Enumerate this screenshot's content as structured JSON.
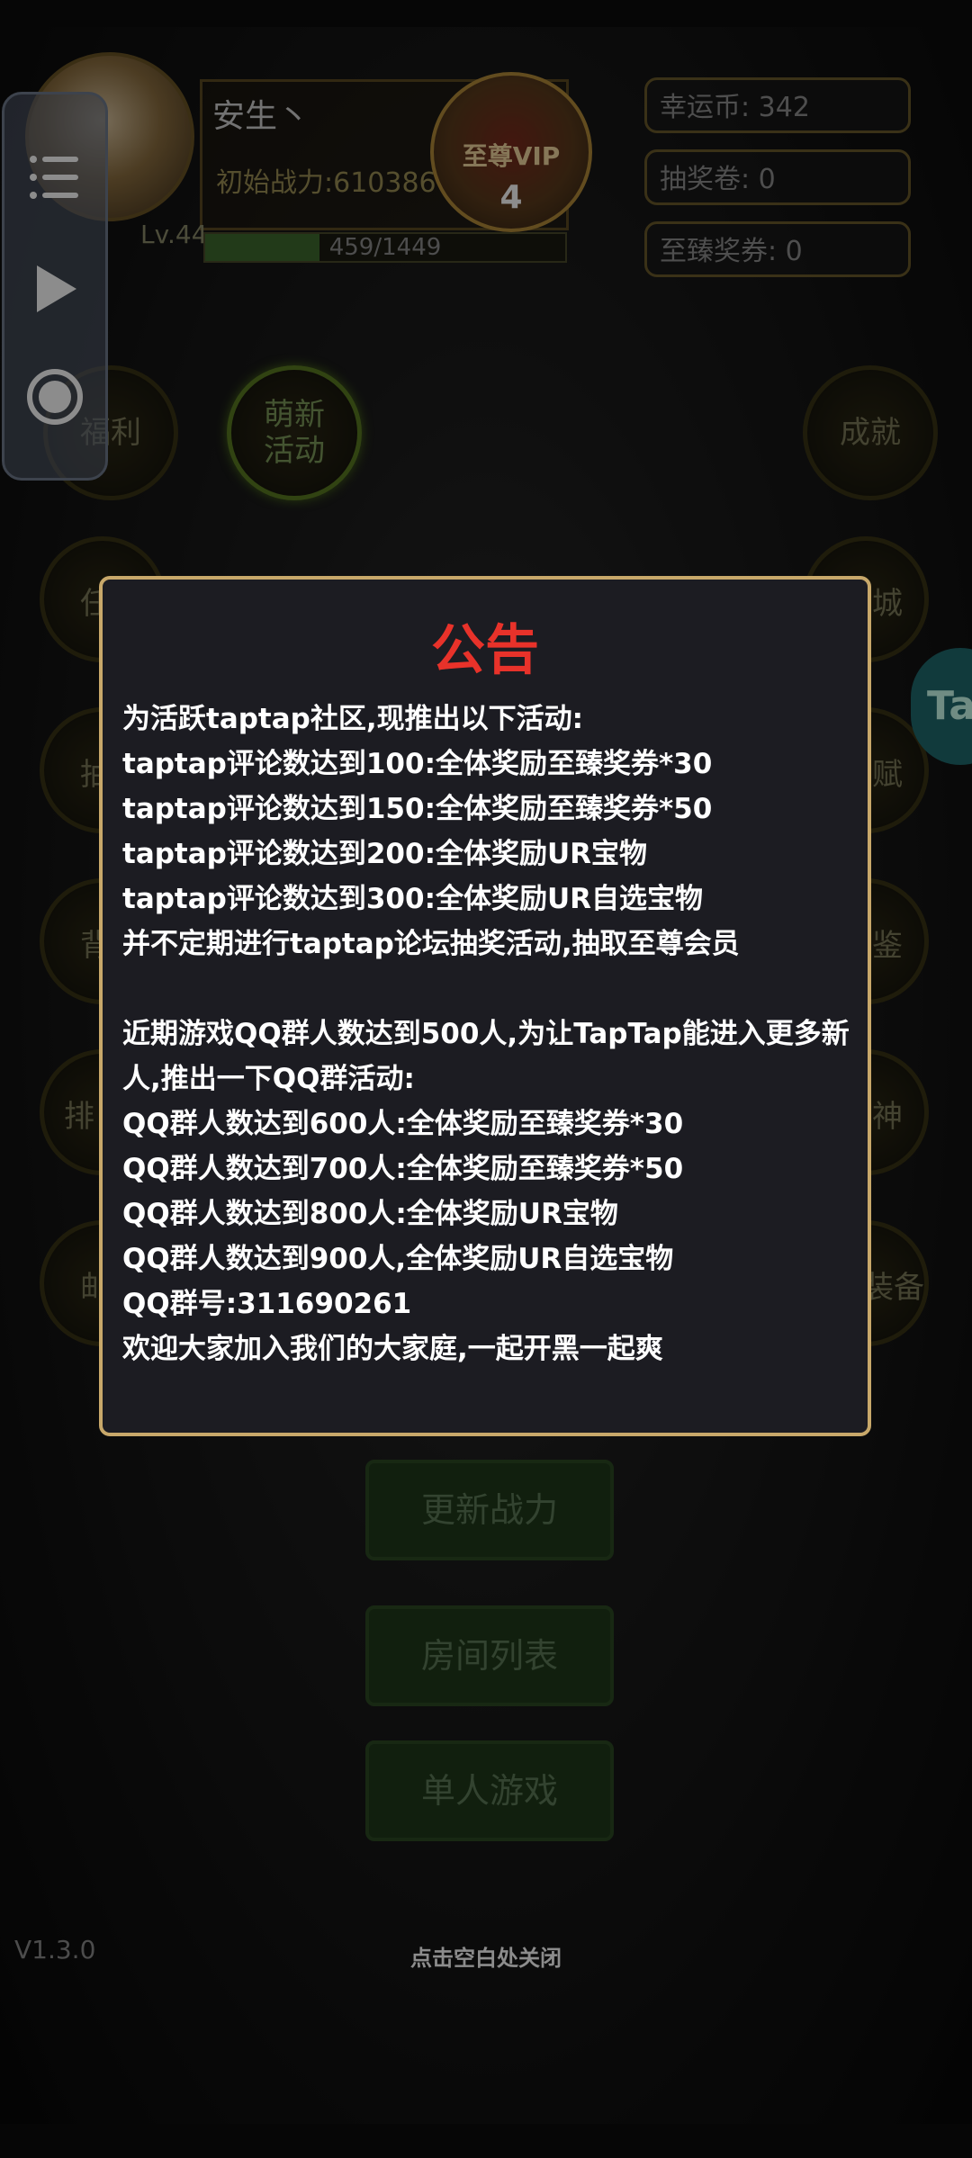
{
  "header": {
    "player_name": "安生丶",
    "power_label": "初始战力:610386",
    "vip_label": "至尊VIP",
    "vip_level": "4",
    "level_label": "Lv.44",
    "xp_text": "459/1449",
    "xp_progress": 0.317
  },
  "currencies": {
    "lucky_coin": "幸运币: 342",
    "lottery_ticket": "抽奖卷: 0",
    "premium_ticket": "至臻奖券: 0"
  },
  "float_panel": {
    "menu_icon": "list-menu-icon",
    "play_icon": "play-icon",
    "record_icon": "record-icon"
  },
  "menu": {
    "welfare": "福利",
    "new_event": "萌新活动",
    "achievement": "成就",
    "left_col": [
      "任",
      "抽",
      "背",
      "排",
      "邮"
    ],
    "right_col": [
      "城",
      "赋",
      "鉴",
      "神",
      "装备"
    ]
  },
  "bottom_buttons": {
    "update_power": "更新战力",
    "room_list": "房间列表",
    "single_game": "单人游戏"
  },
  "version": "V1.3.0",
  "close_hint": "点击空白处关闭",
  "side_bubble": "Ta",
  "dialog": {
    "title": "公告",
    "body": "为活跃taptap社区,现推出以下活动:\ntaptap评论数达到100:全体奖励至臻奖券*30\ntaptap评论数达到150:全体奖励至臻奖券*50\ntaptap评论数达到200:全体奖励UR宝物\ntaptap评论数达到300:全体奖励UR自选宝物\n并不定期进行taptap论坛抽奖活动,抽取至尊会员\n\n近期游戏QQ群人数达到500人,为让TapTap能进入更多新人,推出一下QQ群活动:\nQQ群人数达到600人:全体奖励至臻奖券*30\nQQ群人数达到700人:全体奖励至臻奖券*50\nQQ群人数达到800人:全体奖励UR宝物\nQQ群人数达到900人,全体奖励UR自选宝物\nQQ群号:311690261\n欢迎大家加入我们的大家庭,一起开黑一起爽"
  },
  "colors": {
    "title_red": "#e8322a",
    "dialog_border": "#c8a86a",
    "dialog_bg": "#1c1c22",
    "green_button": "#1f3a1a"
  }
}
